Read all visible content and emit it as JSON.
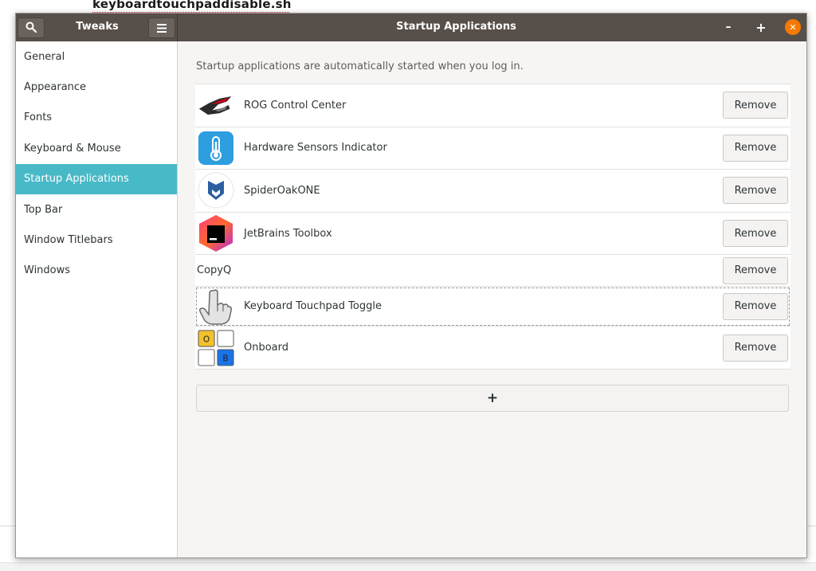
{
  "background": {
    "title": "keyboardtouchpaddisable.sh"
  },
  "headerbar": {
    "left_title": "Tweaks",
    "title": "Startup Applications",
    "minimize_glyph": "–",
    "maximize_glyph": "+",
    "close_glyph": "✕"
  },
  "sidebar": {
    "items": [
      {
        "label": "General"
      },
      {
        "label": "Appearance"
      },
      {
        "label": "Fonts"
      },
      {
        "label": "Keyboard & Mouse"
      },
      {
        "label": "Startup Applications",
        "active": true
      },
      {
        "label": "Top Bar"
      },
      {
        "label": "Window Titlebars"
      },
      {
        "label": "Windows"
      }
    ]
  },
  "content": {
    "description": "Startup applications are automatically started when you log in.",
    "remove_label": "Remove",
    "add_label": "+",
    "apps": [
      {
        "name": "ROG Control Center",
        "icon": "rog-logo-icon"
      },
      {
        "name": "Hardware Sensors Indicator",
        "icon": "thermometer-icon"
      },
      {
        "name": "SpiderOakONE",
        "icon": "spideroak-icon"
      },
      {
        "name": "JetBrains Toolbox",
        "icon": "jetbrains-toolbox-icon"
      },
      {
        "name": "CopyQ",
        "icon": "none"
      },
      {
        "name": "Keyboard Touchpad Toggle",
        "icon": "pointing-hand-icon"
      },
      {
        "name": "Onboard",
        "icon": "onboard-keyboard-icon",
        "icon_keys": [
          "O",
          "B"
        ]
      }
    ]
  },
  "colors": {
    "headerbar": "#574f4a",
    "accent": "#48b9c7",
    "close": "#f57900"
  }
}
